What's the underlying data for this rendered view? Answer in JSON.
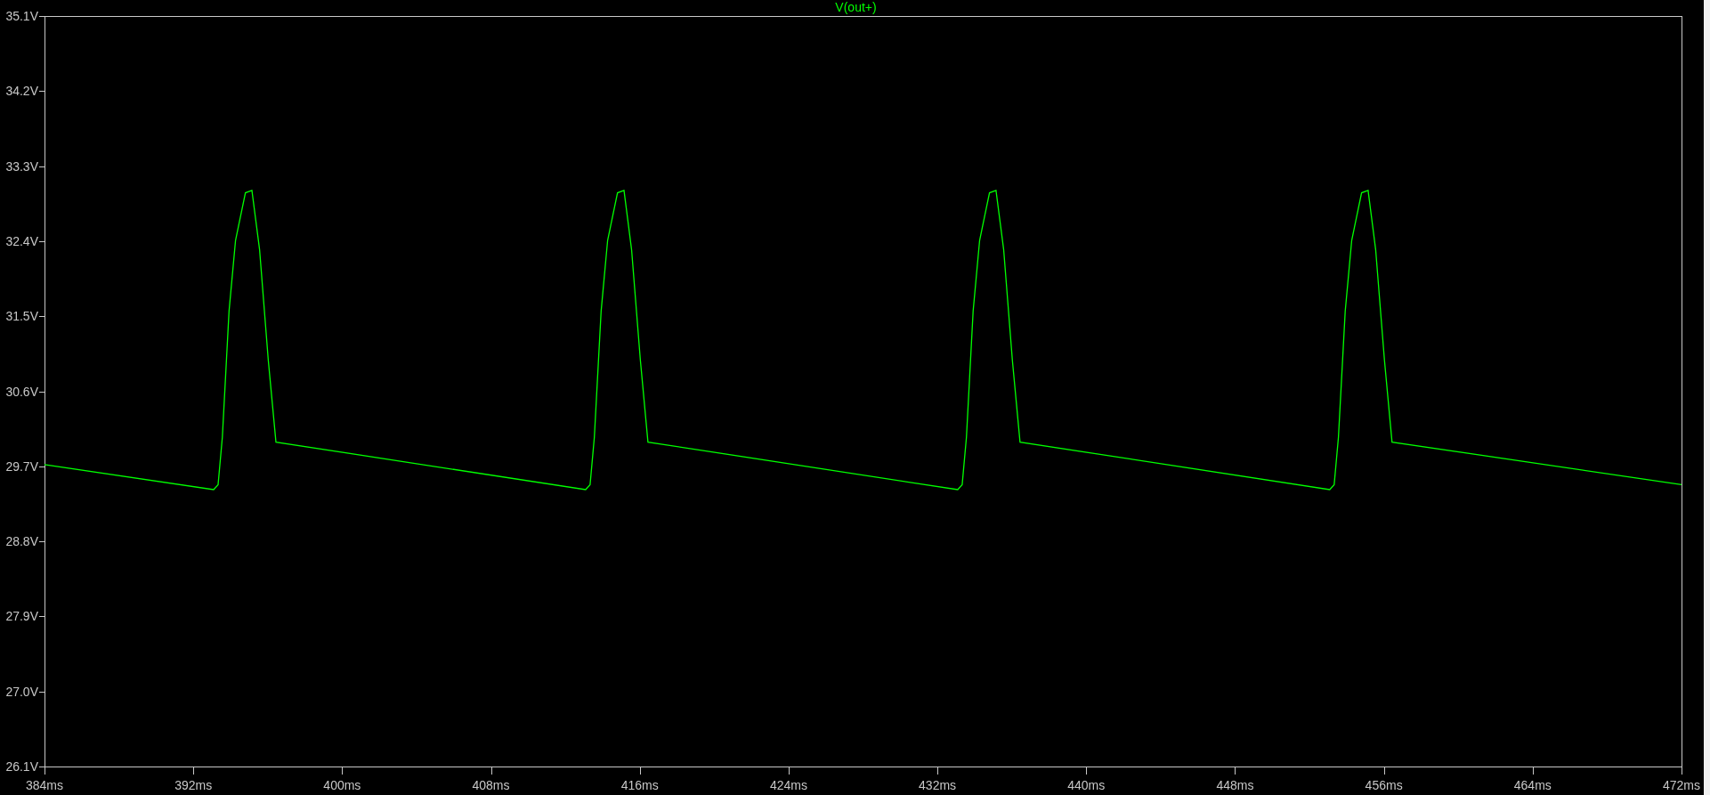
{
  "waveform_plot": {
    "chart_data": {
      "type": "line",
      "x": [
        384,
        393.09,
        393.33,
        393.56,
        393.92,
        394.27,
        394.8,
        395.15,
        395.56,
        396.03,
        396.44,
        413.09,
        413.33,
        413.56,
        413.92,
        414.27,
        414.8,
        415.15,
        415.56,
        416.03,
        416.44,
        433.09,
        433.33,
        433.56,
        433.92,
        434.27,
        434.8,
        435.15,
        435.56,
        436.03,
        436.44,
        453.09,
        453.33,
        453.56,
        453.92,
        454.27,
        454.8,
        455.15,
        455.56,
        456.03,
        456.44,
        472
      ],
      "series": [
        {
          "name": "V(out+)",
          "color": "#00ff00",
          "values": [
            29.72,
            29.42,
            29.48,
            30.05,
            31.56,
            32.41,
            32.98,
            33.01,
            32.3,
            30.97,
            29.99,
            29.42,
            29.48,
            30.05,
            31.56,
            32.41,
            32.98,
            33.01,
            32.3,
            30.97,
            29.99,
            29.42,
            29.48,
            30.05,
            31.56,
            32.41,
            32.98,
            33.01,
            32.3,
            30.97,
            29.99,
            29.42,
            29.48,
            30.05,
            31.56,
            32.41,
            32.98,
            33.01,
            32.3,
            30.97,
            29.99,
            29.48
          ]
        }
      ],
      "xlim": [
        384,
        472
      ],
      "ylim": [
        26.1,
        35.1
      ],
      "xticks": [
        {
          "value": 384,
          "label": "384ms"
        },
        {
          "value": 392,
          "label": "392ms"
        },
        {
          "value": 400,
          "label": "400ms"
        },
        {
          "value": 408,
          "label": "408ms"
        },
        {
          "value": 416,
          "label": "416ms"
        },
        {
          "value": 424,
          "label": "424ms"
        },
        {
          "value": 432,
          "label": "432ms"
        },
        {
          "value": 440,
          "label": "440ms"
        },
        {
          "value": 448,
          "label": "448ms"
        },
        {
          "value": 456,
          "label": "456ms"
        },
        {
          "value": 464,
          "label": "464ms"
        },
        {
          "value": 472,
          "label": "472ms"
        }
      ],
      "yticks": [
        {
          "value": 35.1,
          "label": "35.1V"
        },
        {
          "value": 34.2,
          "label": "34.2V"
        },
        {
          "value": 33.3,
          "label": "33.3V"
        },
        {
          "value": 32.4,
          "label": "32.4V"
        },
        {
          "value": 31.5,
          "label": "31.5V"
        },
        {
          "value": 30.6,
          "label": "30.6V"
        },
        {
          "value": 29.7,
          "label": "29.7V"
        },
        {
          "value": 28.8,
          "label": "28.8V"
        },
        {
          "value": 27.9,
          "label": "27.9V"
        },
        {
          "value": 27.0,
          "label": "27.0V"
        },
        {
          "value": 26.1,
          "label": "26.1V"
        }
      ]
    }
  }
}
